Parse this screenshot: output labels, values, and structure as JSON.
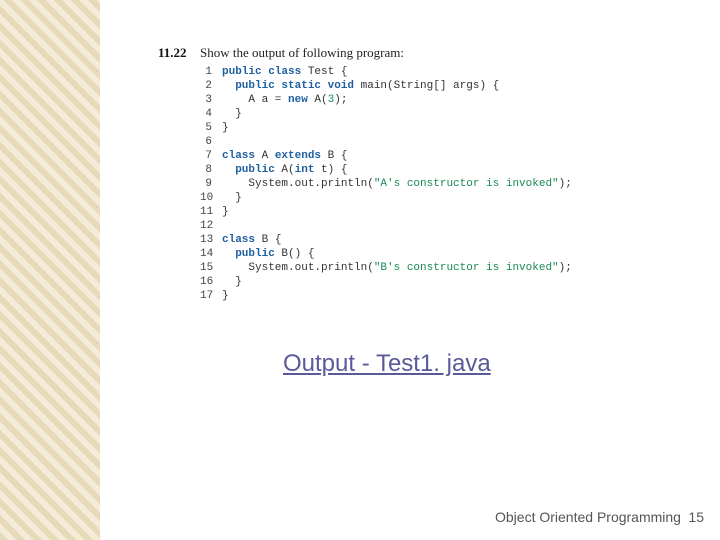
{
  "exercise": {
    "number": "11.22",
    "prompt": "Show the output of following program:"
  },
  "code": {
    "lines": [
      {
        "n": "1",
        "tokens": [
          {
            "t": "public class",
            "c": "kw"
          },
          {
            "t": " Test {",
            "c": ""
          }
        ]
      },
      {
        "n": "2",
        "tokens": [
          {
            "t": "  ",
            "c": ""
          },
          {
            "t": "public static void",
            "c": "kw"
          },
          {
            "t": " main(String[] args) {",
            "c": ""
          }
        ]
      },
      {
        "n": "3",
        "tokens": [
          {
            "t": "    A a = ",
            "c": ""
          },
          {
            "t": "new",
            "c": "kw"
          },
          {
            "t": " A(",
            "c": ""
          },
          {
            "t": "3",
            "c": "str"
          },
          {
            "t": ");",
            "c": ""
          }
        ]
      },
      {
        "n": "4",
        "tokens": [
          {
            "t": "  }",
            "c": ""
          }
        ]
      },
      {
        "n": "5",
        "tokens": [
          {
            "t": "}",
            "c": ""
          }
        ]
      },
      {
        "n": "6",
        "tokens": [
          {
            "t": "",
            "c": ""
          }
        ]
      },
      {
        "n": "7",
        "tokens": [
          {
            "t": "class",
            "c": "kw"
          },
          {
            "t": " A ",
            "c": ""
          },
          {
            "t": "extends",
            "c": "kw"
          },
          {
            "t": " B {",
            "c": ""
          }
        ]
      },
      {
        "n": "8",
        "tokens": [
          {
            "t": "  ",
            "c": ""
          },
          {
            "t": "public",
            "c": "kw"
          },
          {
            "t": " A(",
            "c": ""
          },
          {
            "t": "int",
            "c": "kw"
          },
          {
            "t": " t) {",
            "c": ""
          }
        ]
      },
      {
        "n": "9",
        "tokens": [
          {
            "t": "    System.out.println(",
            "c": ""
          },
          {
            "t": "\"A's constructor is invoked\"",
            "c": "str"
          },
          {
            "t": ");",
            "c": ""
          }
        ]
      },
      {
        "n": "10",
        "tokens": [
          {
            "t": "  }",
            "c": ""
          }
        ]
      },
      {
        "n": "11",
        "tokens": [
          {
            "t": "}",
            "c": ""
          }
        ]
      },
      {
        "n": "12",
        "tokens": [
          {
            "t": "",
            "c": ""
          }
        ]
      },
      {
        "n": "13",
        "tokens": [
          {
            "t": "class",
            "c": "kw"
          },
          {
            "t": " B {",
            "c": ""
          }
        ]
      },
      {
        "n": "14",
        "tokens": [
          {
            "t": "  ",
            "c": ""
          },
          {
            "t": "public",
            "c": "kw"
          },
          {
            "t": " B() {",
            "c": ""
          }
        ]
      },
      {
        "n": "15",
        "tokens": [
          {
            "t": "    System.out.println(",
            "c": ""
          },
          {
            "t": "\"B's constructor is invoked\"",
            "c": "str"
          },
          {
            "t": ");",
            "c": ""
          }
        ]
      },
      {
        "n": "16",
        "tokens": [
          {
            "t": "  }",
            "c": ""
          }
        ]
      },
      {
        "n": "17",
        "tokens": [
          {
            "t": "}",
            "c": ""
          }
        ]
      }
    ]
  },
  "link": {
    "label": "Output - Test1. java"
  },
  "footer": {
    "title": "Object Oriented Programming",
    "page": "15"
  }
}
